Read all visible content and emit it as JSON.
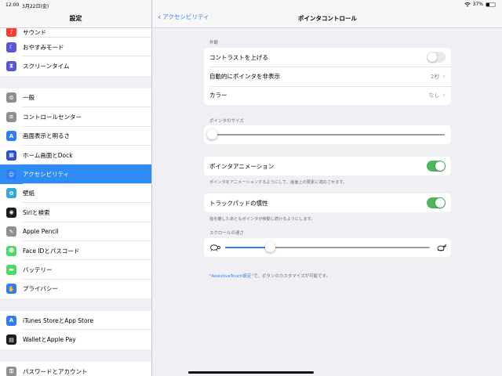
{
  "status": {
    "time": "12:00",
    "date": "3月22日(金)",
    "battery": "37%",
    "battery_level": 0.37
  },
  "sidebar": {
    "title": "設定",
    "groups": [
      [
        {
          "label": "サウンド",
          "icon": "speaker-icon",
          "color": "#ff3b30",
          "partial": true
        },
        {
          "label": "おやすみモード",
          "icon": "moon-icon",
          "color": "#5856d6"
        },
        {
          "label": "スクリーンタイム",
          "icon": "hourglass-icon",
          "color": "#5856d6"
        }
      ],
      [
        {
          "label": "一般",
          "icon": "gear-icon",
          "color": "#8e8e93"
        },
        {
          "label": "コントロールセンター",
          "icon": "toggles-icon",
          "color": "#8e8e93"
        },
        {
          "label": "画面表示と明るさ",
          "icon": "text-size-icon",
          "color": "#2f7cf6"
        },
        {
          "label": "ホーム画面とDock",
          "icon": "grid-icon",
          "color": "#2f50c8"
        },
        {
          "label": "アクセシビリティ",
          "icon": "accessibility-icon",
          "color": "#2f7cf6",
          "selected": true
        },
        {
          "label": "壁紙",
          "icon": "flower-icon",
          "color": "#34aadc"
        },
        {
          "label": "Siriと検索",
          "icon": "siri-icon",
          "color": "#1c1c1e"
        },
        {
          "label": "Apple Pencil",
          "icon": "pencil-icon",
          "color": "#8e8e93"
        },
        {
          "label": "Face IDとパスコード",
          "icon": "faceid-icon",
          "color": "#4cd964"
        },
        {
          "label": "バッテリー",
          "icon": "battery-icon",
          "color": "#4cd964"
        },
        {
          "label": "プライバシー",
          "icon": "hand-icon",
          "color": "#2f7cf6"
        }
      ],
      [
        {
          "label": "iTunes StoreとApp Store",
          "icon": "appstore-icon",
          "color": "#2f7cf6"
        },
        {
          "label": "WalletとApple Pay",
          "icon": "wallet-icon",
          "color": "#1c1c1e"
        }
      ],
      [
        {
          "label": "パスワードとアカウント",
          "icon": "key-icon",
          "color": "#8e8e93"
        }
      ]
    ]
  },
  "nav": {
    "back_label": "アクセシビリティ",
    "title": "ポインタコントロール"
  },
  "appearance": {
    "header": "外観",
    "contrast_label": "コントラストを上げる",
    "contrast_on": false,
    "autohide_label": "自動的にポインタを非表示",
    "autohide_value": "2秒",
    "color_label": "カラー",
    "color_value": "なし"
  },
  "pointer_size": {
    "header": "ポインタのサイズ",
    "value": 0.0
  },
  "animation": {
    "label": "ポインタアニメーション",
    "on": true,
    "footnote": "ポインタをアニメーションするようにして、画面上の要素に適応させます。"
  },
  "trackpad": {
    "label": "トラックパッドの慣性",
    "on": true,
    "footnote": "指を離したあともポインタが移動し続けるようにします。"
  },
  "scroll": {
    "header": "スクロールの速さ",
    "value": 0.22
  },
  "assistive": {
    "link": "\"AssistiveTouch設定\"",
    "text": "で、ボタンのカスタマイズが可能です。"
  }
}
